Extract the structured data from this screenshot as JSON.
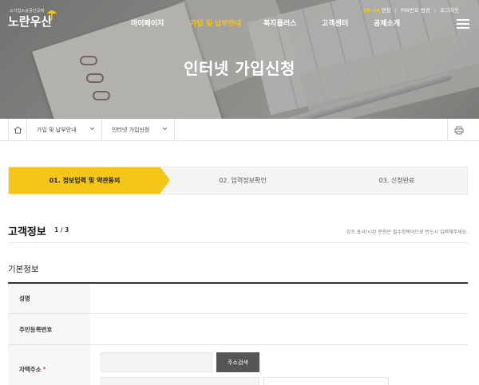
{
  "logo": {
    "sub": "소기업소상공인공제",
    "main": "노란우산"
  },
  "util": {
    "time": "29:46",
    "extend": "연장",
    "pin_change": "PIN번호 변경",
    "logout": "로그아웃"
  },
  "gnb": [
    {
      "label": "마이페이지"
    },
    {
      "label": "가입 및 납부안내"
    },
    {
      "label": "복지플러스"
    },
    {
      "label": "고객센터"
    },
    {
      "label": "공제소개"
    }
  ],
  "hero": {
    "title": "인터넷 가입신청"
  },
  "breadcrumb": {
    "level1": "가입 및 납부안내",
    "level2": "인터넷 가입신청"
  },
  "steps": [
    {
      "label": "01. 정보입력 및 약관동의"
    },
    {
      "label": "02. 입력정보확인"
    },
    {
      "label": "03. 신청완료"
    }
  ],
  "section": {
    "title": "고객정보",
    "page": "1 / 3",
    "note": "강조 표시(•)된 문항은 필수항목이므로 반드시 입력해주세요."
  },
  "basic": {
    "title": "기본정보",
    "name_label": "성명",
    "rrn_label": "주민등록번호",
    "address_label": "자택주소",
    "address_required": "*",
    "search_button": "주소검색"
  },
  "colors": {
    "accent": "#f5c518",
    "dark": "#555555"
  }
}
